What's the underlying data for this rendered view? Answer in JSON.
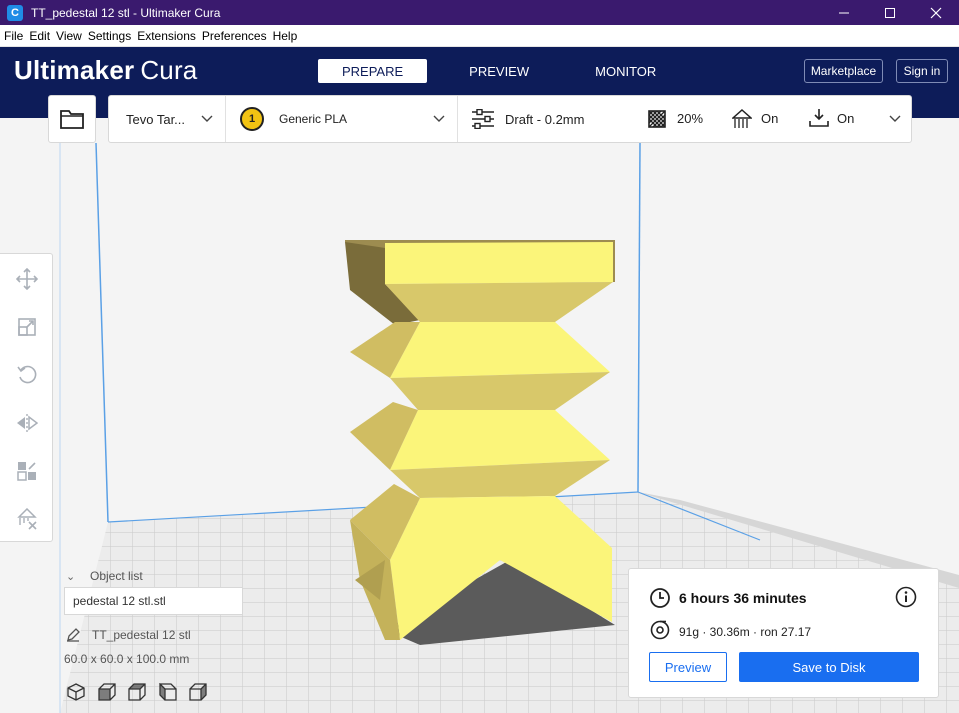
{
  "window": {
    "title": "TT_pedestal 12 stl - Ultimaker Cura",
    "app_icon": "C"
  },
  "menu": [
    "File",
    "Edit",
    "View",
    "Settings",
    "Extensions",
    "Preferences",
    "Help"
  ],
  "header": {
    "brand": "Ultimaker",
    "product": "Cura",
    "tabs": [
      "PREPARE",
      "PREVIEW",
      "MONITOR"
    ],
    "active_tab": "PREPARE",
    "marketplace_label": "Marketplace",
    "signin_label": "Sign in"
  },
  "toolbar": {
    "printer": "Tevo Tar...",
    "extruder_number": "1",
    "material": "Generic PLA",
    "profile": "Draft - 0.2mm",
    "infill": "20%",
    "support": "On",
    "adhesion": "On"
  },
  "object_list": {
    "title": "Object list",
    "field_value": "pedestal 12 stl.stl",
    "object_name": "TT_pedestal 12 stl",
    "dimensions": "60.0 x 60.0 x 100.0 mm"
  },
  "print": {
    "time": "6 hours 36 minutes",
    "material_usage": "91g · 30.36m · ron 27.17",
    "preview_label": "Preview",
    "save_label": "Save to Disk"
  },
  "colors": {
    "header_bg": "#0d1c59",
    "titlebar_bg": "#3a1a6e",
    "accent": "#196ef0",
    "model": "#f5ea6e"
  }
}
